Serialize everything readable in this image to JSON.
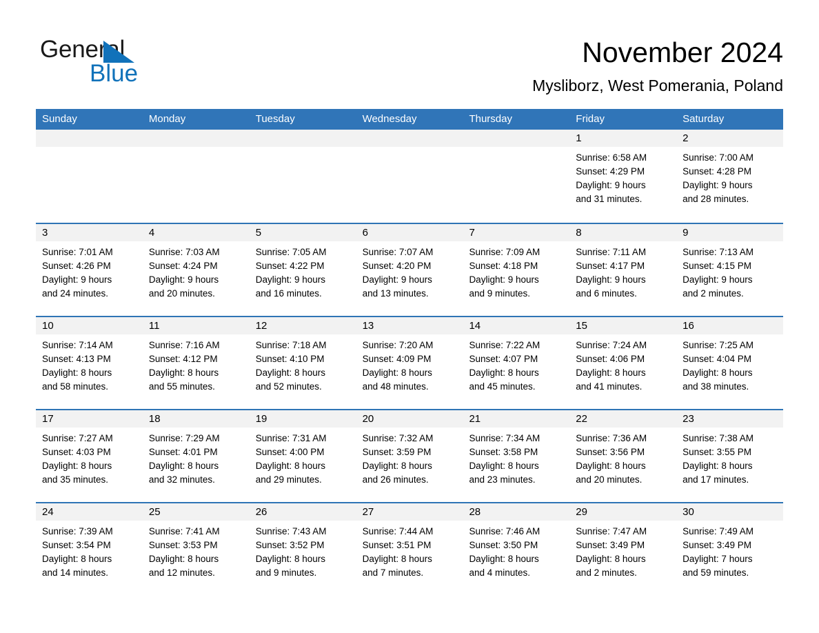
{
  "brand": {
    "name_part1": "General",
    "name_part2": "Blue",
    "accent_color": "#1172BA"
  },
  "header": {
    "title": "November 2024",
    "subtitle": "Mysliborz, West Pomerania, Poland"
  },
  "calendar": {
    "header_bg": "#3075B8",
    "row_divider_color": "#2E74B5",
    "daynum_bg": "#f2f2f2",
    "weekdays": [
      "Sunday",
      "Monday",
      "Tuesday",
      "Wednesday",
      "Thursday",
      "Friday",
      "Saturday"
    ],
    "weeks": [
      [
        {
          "day": "",
          "lines": []
        },
        {
          "day": "",
          "lines": []
        },
        {
          "day": "",
          "lines": []
        },
        {
          "day": "",
          "lines": []
        },
        {
          "day": "",
          "lines": []
        },
        {
          "day": "1",
          "lines": [
            "Sunrise: 6:58 AM",
            "Sunset: 4:29 PM",
            "Daylight: 9 hours",
            "and 31 minutes."
          ]
        },
        {
          "day": "2",
          "lines": [
            "Sunrise: 7:00 AM",
            "Sunset: 4:28 PM",
            "Daylight: 9 hours",
            "and 28 minutes."
          ]
        }
      ],
      [
        {
          "day": "3",
          "lines": [
            "Sunrise: 7:01 AM",
            "Sunset: 4:26 PM",
            "Daylight: 9 hours",
            "and 24 minutes."
          ]
        },
        {
          "day": "4",
          "lines": [
            "Sunrise: 7:03 AM",
            "Sunset: 4:24 PM",
            "Daylight: 9 hours",
            "and 20 minutes."
          ]
        },
        {
          "day": "5",
          "lines": [
            "Sunrise: 7:05 AM",
            "Sunset: 4:22 PM",
            "Daylight: 9 hours",
            "and 16 minutes."
          ]
        },
        {
          "day": "6",
          "lines": [
            "Sunrise: 7:07 AM",
            "Sunset: 4:20 PM",
            "Daylight: 9 hours",
            "and 13 minutes."
          ]
        },
        {
          "day": "7",
          "lines": [
            "Sunrise: 7:09 AM",
            "Sunset: 4:18 PM",
            "Daylight: 9 hours",
            "and 9 minutes."
          ]
        },
        {
          "day": "8",
          "lines": [
            "Sunrise: 7:11 AM",
            "Sunset: 4:17 PM",
            "Daylight: 9 hours",
            "and 6 minutes."
          ]
        },
        {
          "day": "9",
          "lines": [
            "Sunrise: 7:13 AM",
            "Sunset: 4:15 PM",
            "Daylight: 9 hours",
            "and 2 minutes."
          ]
        }
      ],
      [
        {
          "day": "10",
          "lines": [
            "Sunrise: 7:14 AM",
            "Sunset: 4:13 PM",
            "Daylight: 8 hours",
            "and 58 minutes."
          ]
        },
        {
          "day": "11",
          "lines": [
            "Sunrise: 7:16 AM",
            "Sunset: 4:12 PM",
            "Daylight: 8 hours",
            "and 55 minutes."
          ]
        },
        {
          "day": "12",
          "lines": [
            "Sunrise: 7:18 AM",
            "Sunset: 4:10 PM",
            "Daylight: 8 hours",
            "and 52 minutes."
          ]
        },
        {
          "day": "13",
          "lines": [
            "Sunrise: 7:20 AM",
            "Sunset: 4:09 PM",
            "Daylight: 8 hours",
            "and 48 minutes."
          ]
        },
        {
          "day": "14",
          "lines": [
            "Sunrise: 7:22 AM",
            "Sunset: 4:07 PM",
            "Daylight: 8 hours",
            "and 45 minutes."
          ]
        },
        {
          "day": "15",
          "lines": [
            "Sunrise: 7:24 AM",
            "Sunset: 4:06 PM",
            "Daylight: 8 hours",
            "and 41 minutes."
          ]
        },
        {
          "day": "16",
          "lines": [
            "Sunrise: 7:25 AM",
            "Sunset: 4:04 PM",
            "Daylight: 8 hours",
            "and 38 minutes."
          ]
        }
      ],
      [
        {
          "day": "17",
          "lines": [
            "Sunrise: 7:27 AM",
            "Sunset: 4:03 PM",
            "Daylight: 8 hours",
            "and 35 minutes."
          ]
        },
        {
          "day": "18",
          "lines": [
            "Sunrise: 7:29 AM",
            "Sunset: 4:01 PM",
            "Daylight: 8 hours",
            "and 32 minutes."
          ]
        },
        {
          "day": "19",
          "lines": [
            "Sunrise: 7:31 AM",
            "Sunset: 4:00 PM",
            "Daylight: 8 hours",
            "and 29 minutes."
          ]
        },
        {
          "day": "20",
          "lines": [
            "Sunrise: 7:32 AM",
            "Sunset: 3:59 PM",
            "Daylight: 8 hours",
            "and 26 minutes."
          ]
        },
        {
          "day": "21",
          "lines": [
            "Sunrise: 7:34 AM",
            "Sunset: 3:58 PM",
            "Daylight: 8 hours",
            "and 23 minutes."
          ]
        },
        {
          "day": "22",
          "lines": [
            "Sunrise: 7:36 AM",
            "Sunset: 3:56 PM",
            "Daylight: 8 hours",
            "and 20 minutes."
          ]
        },
        {
          "day": "23",
          "lines": [
            "Sunrise: 7:38 AM",
            "Sunset: 3:55 PM",
            "Daylight: 8 hours",
            "and 17 minutes."
          ]
        }
      ],
      [
        {
          "day": "24",
          "lines": [
            "Sunrise: 7:39 AM",
            "Sunset: 3:54 PM",
            "Daylight: 8 hours",
            "and 14 minutes."
          ]
        },
        {
          "day": "25",
          "lines": [
            "Sunrise: 7:41 AM",
            "Sunset: 3:53 PM",
            "Daylight: 8 hours",
            "and 12 minutes."
          ]
        },
        {
          "day": "26",
          "lines": [
            "Sunrise: 7:43 AM",
            "Sunset: 3:52 PM",
            "Daylight: 8 hours",
            "and 9 minutes."
          ]
        },
        {
          "day": "27",
          "lines": [
            "Sunrise: 7:44 AM",
            "Sunset: 3:51 PM",
            "Daylight: 8 hours",
            "and 7 minutes."
          ]
        },
        {
          "day": "28",
          "lines": [
            "Sunrise: 7:46 AM",
            "Sunset: 3:50 PM",
            "Daylight: 8 hours",
            "and 4 minutes."
          ]
        },
        {
          "day": "29",
          "lines": [
            "Sunrise: 7:47 AM",
            "Sunset: 3:49 PM",
            "Daylight: 8 hours",
            "and 2 minutes."
          ]
        },
        {
          "day": "30",
          "lines": [
            "Sunrise: 7:49 AM",
            "Sunset: 3:49 PM",
            "Daylight: 7 hours",
            "and 59 minutes."
          ]
        }
      ]
    ]
  }
}
